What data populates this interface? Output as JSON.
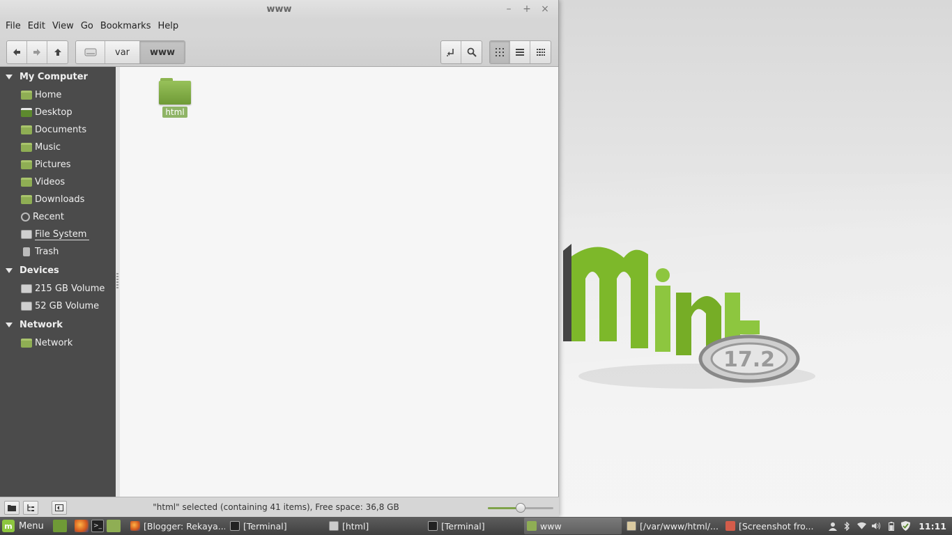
{
  "window": {
    "title": "www",
    "controls": {
      "minimize": "–",
      "maximize": "+",
      "close": "×"
    }
  },
  "menubar": [
    "File",
    "Edit",
    "View",
    "Go",
    "Bookmarks",
    "Help"
  ],
  "toolbar": {
    "breadcrumbs": [
      "var",
      "www"
    ]
  },
  "sidebar": {
    "sections": [
      {
        "title": "My Computer",
        "items": [
          "Home",
          "Desktop",
          "Documents",
          "Music",
          "Pictures",
          "Videos",
          "Downloads",
          "Recent",
          "File System",
          "Trash"
        ]
      },
      {
        "title": "Devices",
        "items": [
          "215 GB Volume",
          "52 GB Volume"
        ]
      },
      {
        "title": "Network",
        "items": [
          "Network"
        ]
      }
    ]
  },
  "content": {
    "items": [
      {
        "name": "html",
        "type": "folder",
        "selected": true
      }
    ]
  },
  "statusbar": {
    "text": "\"html\" selected (containing 41 items), Free space: 36,8 GB",
    "zoom_fraction": 0.5
  },
  "panel": {
    "menu_label": "Menu",
    "tasks": [
      "[Blogger: Rekaya...",
      "[Terminal]",
      "[html]",
      "[Terminal]",
      "www",
      "[/var/www/html/...",
      "[Screenshot fro..."
    ],
    "clock": "11:11"
  },
  "wallpaper": {
    "brand_text": "Mint",
    "version": "17.2"
  },
  "colors": {
    "accent": "#8dc63f",
    "sidebar_bg": "#4b4b4b",
    "selection": "#8fb466"
  }
}
